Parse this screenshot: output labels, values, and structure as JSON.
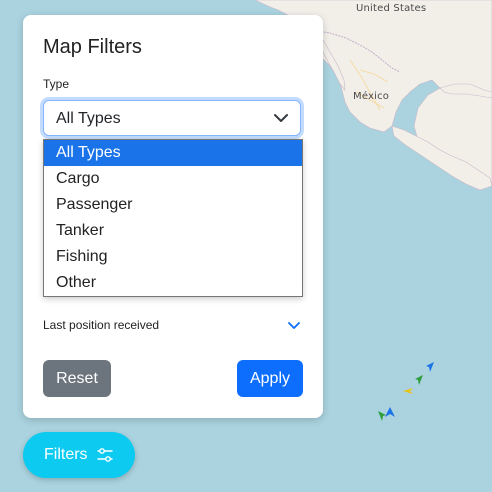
{
  "map": {
    "labels": {
      "us": "United States",
      "mexico": "México"
    },
    "colors": {
      "water": "#aad3df",
      "land": "#f2efe9"
    }
  },
  "panel": {
    "title": "Map Filters",
    "type_label": "Type",
    "type_select": {
      "value": "All Types",
      "options": [
        "All Types",
        "Cargo",
        "Passenger",
        "Tanker",
        "Fishing",
        "Other"
      ],
      "selected_index": 0
    },
    "last_position_label": "Last position received",
    "reset_label": "Reset",
    "apply_label": "Apply"
  },
  "fab": {
    "label": "Filters",
    "icon": "sliders-icon"
  },
  "vessels": [
    {
      "type_color": "#1a73e8"
    },
    {
      "type_color": "#2e9e3e"
    },
    {
      "type_color": "#e8c21a"
    },
    {
      "type_color": "#2e9e3e"
    },
    {
      "type_color": "#1a73e8"
    }
  ],
  "colors": {
    "primary": "#0d6efd",
    "secondary": "#6c757d",
    "info": "#0dcaf0"
  }
}
